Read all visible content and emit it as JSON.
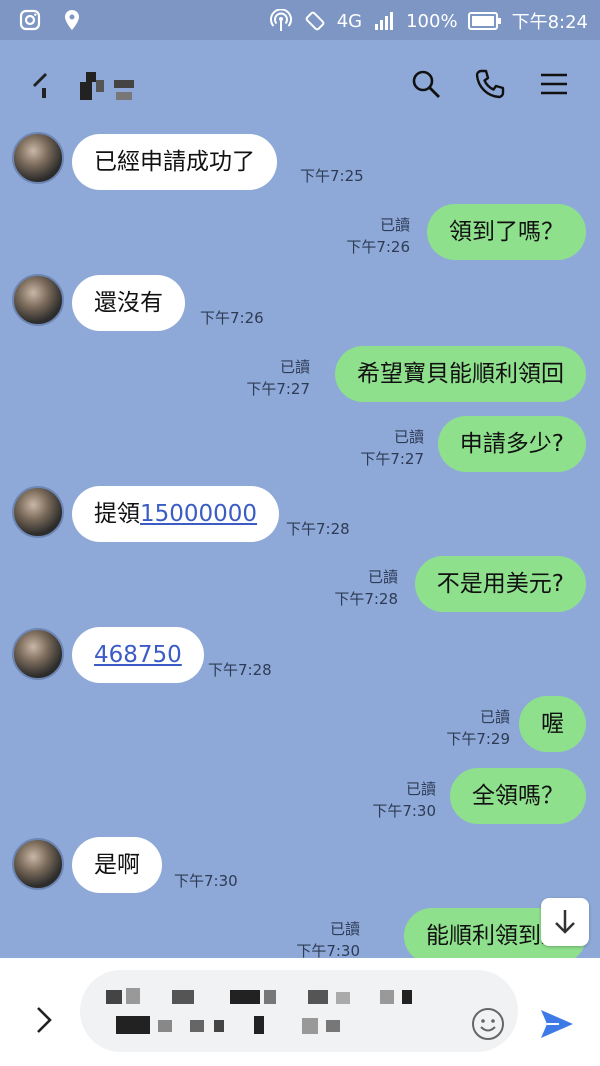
{
  "status_bar": {
    "network": "4G",
    "battery": "100%",
    "time": "下午8:24"
  },
  "header": {
    "icons": [
      "back-icon",
      "search-icon",
      "phone-icon",
      "menu-icon"
    ]
  },
  "messages": [
    {
      "dir": "in",
      "text": "已經申請成功了",
      "time": "下午7:25"
    },
    {
      "dir": "out",
      "text": "領到了嗎？",
      "read": "已讀",
      "time": "下午7:26"
    },
    {
      "dir": "in",
      "text": "還沒有",
      "time": "下午7:26"
    },
    {
      "dir": "out",
      "text": "希望寶貝能順利領回",
      "read": "已讀",
      "time": "下午7:27"
    },
    {
      "dir": "out",
      "text": "申請多少?",
      "read": "已讀",
      "time": "下午7:27"
    },
    {
      "dir": "in",
      "prefix": "提領",
      "link": "15000000",
      "time": "下午7:28"
    },
    {
      "dir": "out",
      "text": "不是用美元?",
      "read": "已讀",
      "time": "下午7:28"
    },
    {
      "dir": "in",
      "link": "468750",
      "time": "下午7:28"
    },
    {
      "dir": "out",
      "text": "喔",
      "read": "已讀",
      "time": "下午7:29"
    },
    {
      "dir": "out",
      "text": "全領嗎？",
      "read": "已讀",
      "time": "下午7:30"
    },
    {
      "dir": "in",
      "text": "是啊",
      "time": "下午7:30"
    },
    {
      "dir": "out",
      "text": "能順利領到最",
      "read": "已讀",
      "time": "下午7:30"
    }
  ],
  "colors": {
    "background": "#8ea9d8",
    "incoming_bubble": "#ffffff",
    "outgoing_bubble": "#8ee08c",
    "link": "#3b5cc4",
    "send": "#3d7ae8"
  }
}
